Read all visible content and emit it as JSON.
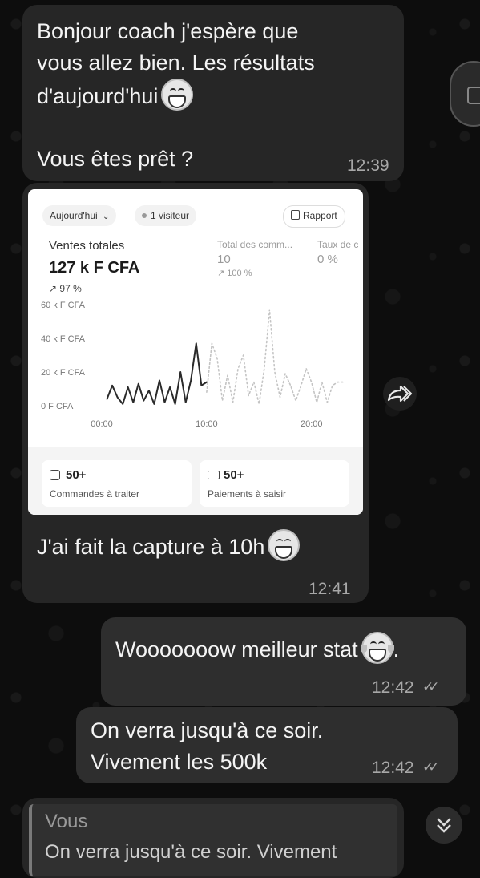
{
  "messages": {
    "m1": {
      "lines": [
        "Bonjour coach j'espère que",
        "vous allez bien. Les résultats",
        "d'aujourd'hui"
      ],
      "line4": "Vous êtes prêt ?",
      "time": "12:39"
    },
    "m2": {
      "caption": "J'ai fait la capture à 10h",
      "time": "12:41"
    },
    "m3": {
      "text": "Wooooooow meilleur stat",
      "suffix": ".",
      "time": "12:42"
    },
    "m4": {
      "lines": [
        "On verra jusqu'à ce soir.",
        "Vivement les 500k"
      ],
      "time": "12:42"
    },
    "reply": {
      "author": "Vous",
      "preview": "On verra jusqu'à ce soir. Vivement"
    }
  },
  "screenshot": {
    "filter_label": "Aujourd'hui",
    "visitors_label": "1 visiteur",
    "report_label": "Rapport",
    "total_sales_label": "Ventes totales",
    "total_sales_value": "127 k F CFA",
    "total_sales_change": "97 %",
    "orders_label": "Total des comm...",
    "orders_value": "10",
    "orders_change": "100 %",
    "rate_label": "Taux de c",
    "rate_value": "0 %",
    "tile1_value": "50+",
    "tile1_label": "Commandes à traiter",
    "tile2_value": "50+",
    "tile2_label": "Paiements à saisir"
  },
  "chart_data": {
    "type": "line",
    "y_ticks": [
      "60 k F CFA",
      "40 k F CFA",
      "20 k F CFA",
      "0 F CFA"
    ],
    "x_ticks": [
      "00:00",
      "10:00",
      "20:00"
    ],
    "ylim": [
      0,
      60000
    ],
    "xlim": [
      0,
      23
    ],
    "series": [
      {
        "style": "solid",
        "x": [
          0.5,
          1.0,
          1.5,
          2.0,
          2.5,
          3.0,
          3.5,
          4.0,
          4.5,
          5.0,
          5.5,
          6.0,
          6.5,
          7.0,
          7.5,
          8.0,
          8.5,
          9.0,
          9.5,
          10.0
        ],
        "y": [
          4000,
          12000,
          5000,
          1000,
          11000,
          2000,
          13000,
          3000,
          9000,
          1000,
          15000,
          2000,
          11000,
          1000,
          20000,
          2000,
          15000,
          37000,
          12000,
          14000
        ]
      },
      {
        "style": "dotted",
        "x": [
          10.0,
          10.5,
          11.0,
          11.5,
          12.0,
          12.5,
          13.0,
          13.5,
          14.0,
          14.5,
          15.0,
          15.5,
          16.0,
          16.5,
          17.0,
          17.5,
          18.0,
          18.5,
          19.0,
          19.5,
          20.0,
          20.5,
          21.0,
          21.5,
          22.0,
          22.5,
          23.0
        ],
        "y": [
          8000,
          37000,
          28000,
          3000,
          18000,
          2000,
          22000,
          30000,
          6000,
          14000,
          1000,
          22000,
          57000,
          20000,
          5000,
          19000,
          12000,
          3000,
          12000,
          22000,
          14000,
          2000,
          14000,
          2000,
          12000,
          14000,
          14000
        ]
      }
    ]
  }
}
